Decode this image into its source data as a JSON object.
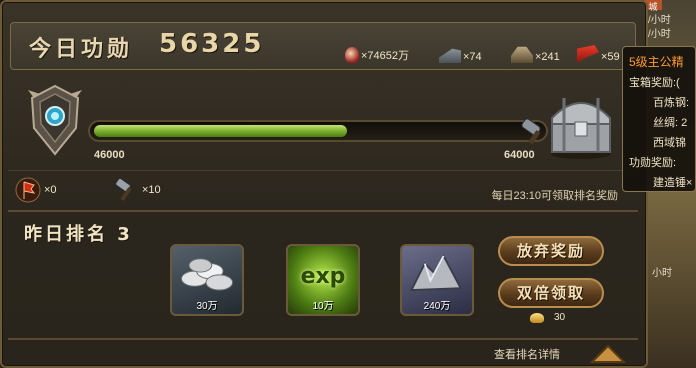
{
  "header": {
    "merit_label": "今日功勋",
    "merit_value": "56325",
    "resources": [
      {
        "icon": "coin-icon",
        "value": "×74652万"
      },
      {
        "icon": "cannon-icon",
        "value": "×74"
      },
      {
        "icon": "cart-icon",
        "value": "×241"
      },
      {
        "icon": "red-flag-icon",
        "value": "×59"
      }
    ]
  },
  "progress": {
    "min_label": "46000",
    "max_label": "64000",
    "fraction": 0.56
  },
  "items": {
    "flag_count": "×0",
    "hammer_count": "×10",
    "daily_note": "每日23:10可领取排名奖励"
  },
  "ranking": {
    "title": "昨日排名 3",
    "rewards": [
      {
        "name": "silver",
        "qty": "30万"
      },
      {
        "name": "exp",
        "label": "exp",
        "qty": "10万"
      },
      {
        "name": "ore",
        "qty": "240万"
      }
    ],
    "give_up_label": "放弃奖励",
    "double_label": "双倍领取",
    "ingot_cost": "30"
  },
  "footer": {
    "details_label": "查看排名详情"
  },
  "tooltip": {
    "title": "5级主公精",
    "line1": "宝箱奖励:(",
    "line2": "百炼钢:",
    "line3": "丝绸: 2",
    "line4": "西域锦",
    "line5": "功勋奖励:",
    "line6": "建造锤×"
  },
  "side": {
    "time1": "/小时",
    "time2": "/小时",
    "time3": "小时",
    "tab": "城"
  },
  "colors": {
    "bar_fill": "#7bb02c",
    "tooltip_title": "#ff9a2e",
    "button_border": "#b88d4f"
  }
}
